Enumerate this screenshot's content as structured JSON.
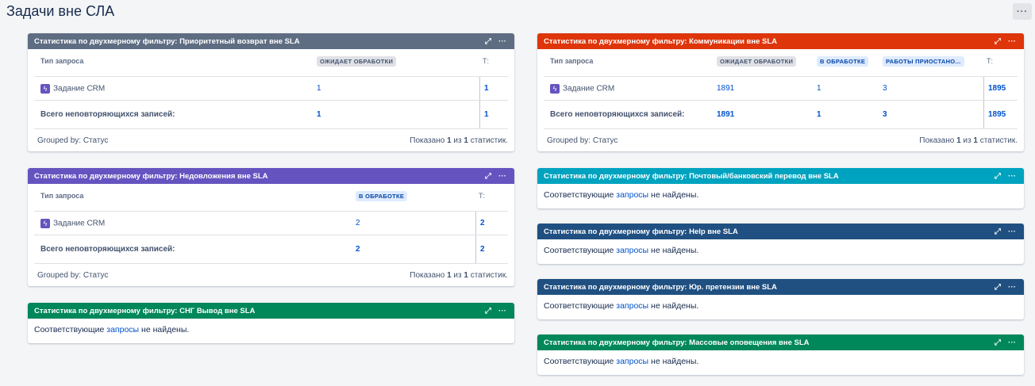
{
  "page": {
    "title": "Задачи вне СЛА",
    "more_label": "···"
  },
  "colors": {
    "slate": "#5e6d82",
    "red": "#de350b",
    "purple": "#6554c0",
    "green": "#00875a",
    "teal": "#00a3bf",
    "navy": "#205081"
  },
  "icons": {
    "expand": "expand-icon",
    "more": "more-icon",
    "crm": "bolt-icon"
  },
  "common": {
    "type_header": "Тип запроса",
    "total_header": "Т:",
    "row_label": "Задание CRM",
    "total_label": "Всего неповторяющихся записей:",
    "grouped_by": "Grouped by: Статус",
    "shown_prefix": "Показано",
    "shown_of": "из",
    "shown_suffix": "статистик.",
    "empty_prefix": "Соответствующие",
    "empty_link": "запросы",
    "empty_suffix": "не найдены."
  },
  "gadgets": {
    "priority": {
      "title": "Статистика по двухмерному фильтру: Приоритетный возврат вне SLA",
      "status": "ОЖИДАЕТ ОБРАБОТКИ",
      "value": "1",
      "row_total": "1",
      "sum_value": "1",
      "sum_total": "1",
      "shown": "1",
      "of": "1"
    },
    "communications": {
      "title": "Статистика по двухмерному фильтру: Коммуникации вне SLA",
      "status1": "ОЖИДАЕТ ОБРАБОТКИ",
      "status2": "В ОБРАБОТКЕ",
      "status3": "РАБОТЫ ПРИОСТАНО...",
      "v1": "1891",
      "v2": "1",
      "v3": "3",
      "vt": "1895",
      "s1": "1891",
      "s2": "1",
      "s3": "3",
      "st": "1895",
      "shown": "1",
      "of": "1"
    },
    "nedovlozh": {
      "title": "Статистика по двухмерному фильтру: Недовложения вне SLA",
      "status": "В ОБРАБОТКЕ",
      "value": "2",
      "row_total": "2",
      "sum_value": "2",
      "sum_total": "2",
      "shown": "1",
      "of": "1"
    },
    "sng": {
      "title": "Статистика по двухмерному фильтру: СНГ Вывод вне SLA"
    },
    "postal": {
      "title": "Статистика по двухмерному фильтру: Почтовый/банковский перевод вне SLA"
    },
    "help": {
      "title": "Статистика по двухмерному фильтру: Help вне SLA"
    },
    "legal": {
      "title": "Статистика по двухмерному фильтру: Юр. претензии вне SLA"
    },
    "mass": {
      "title": "Статистика по двухмерному фильтру: Массовые оповещения вне SLA"
    }
  }
}
